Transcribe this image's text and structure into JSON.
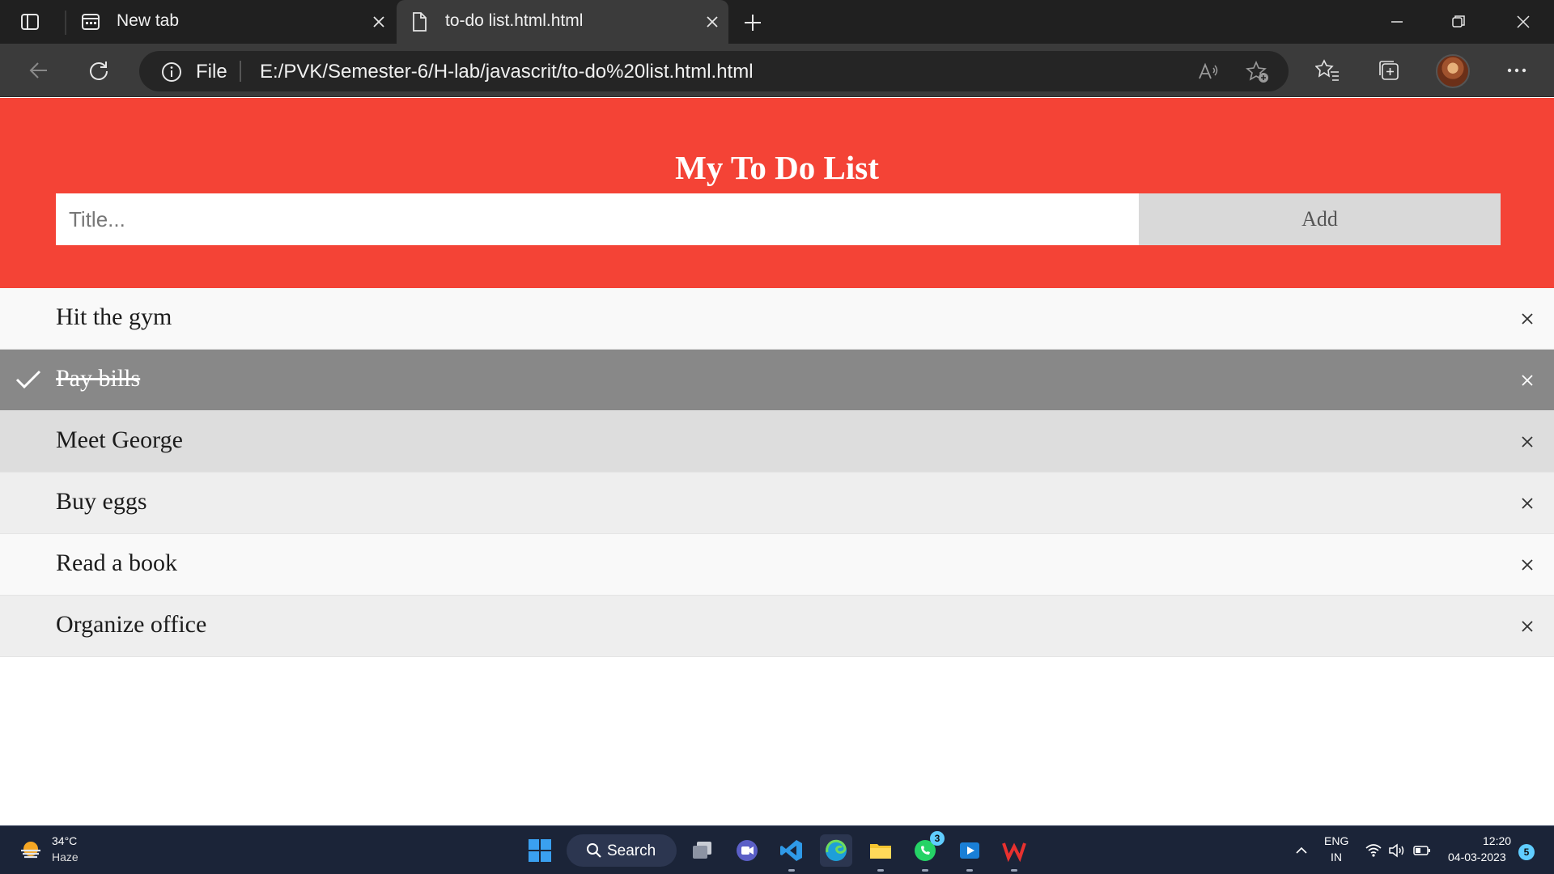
{
  "browser": {
    "tabs": [
      {
        "title": "New tab",
        "active": false
      },
      {
        "title": "to-do list.html.html",
        "active": true
      }
    ],
    "address": {
      "scheme_label": "File",
      "url": "E:/PVK/Semester-6/H-lab/javascrit/to-do%20list.html.html"
    }
  },
  "page": {
    "title": "My To Do List",
    "input_placeholder": "Title...",
    "add_label": "Add",
    "accent_color": "#f44336",
    "items": [
      {
        "text": "Hit the gym",
        "checked": false,
        "bg": "#f9f9f9"
      },
      {
        "text": "Pay bills",
        "checked": true,
        "bg": "#888888"
      },
      {
        "text": "Meet George",
        "checked": false,
        "bg": "#dddddd"
      },
      {
        "text": "Buy eggs",
        "checked": false,
        "bg": "#eeeeee"
      },
      {
        "text": "Read a book",
        "checked": false,
        "bg": "#f9f9f9"
      },
      {
        "text": "Organize office",
        "checked": false,
        "bg": "#eeeeee"
      }
    ],
    "item_close_glyph": "×"
  },
  "taskbar": {
    "weather": {
      "temp": "34°C",
      "condition": "Haze"
    },
    "search_label": "Search",
    "whatsapp_badge": "3",
    "tray": {
      "lang_line1": "ENG",
      "lang_line2": "IN",
      "time": "12:20",
      "date": "04-03-2023",
      "notifications": "5"
    }
  }
}
